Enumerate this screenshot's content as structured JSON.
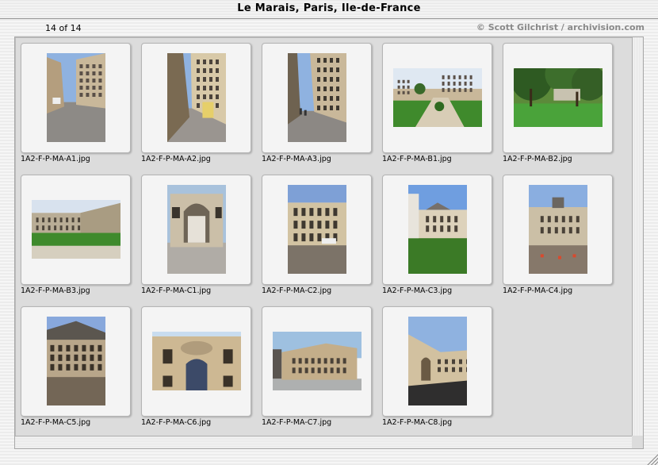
{
  "window": {
    "title": "Le Marais, Paris, Ile-de-France"
  },
  "header": {
    "counter": "14 of 14",
    "copyright": "© Scott Gilchrist / archivision.com"
  },
  "images": [
    {
      "filename": "1A2-F-P-MA-A1.jpg",
      "orientation": "portrait",
      "scene": "street-corner"
    },
    {
      "filename": "1A2-F-P-MA-A2.jpg",
      "orientation": "portrait",
      "scene": "narrow-street"
    },
    {
      "filename": "1A2-F-P-MA-A3.jpg",
      "orientation": "portrait",
      "scene": "street-tall"
    },
    {
      "filename": "1A2-F-P-MA-B1.jpg",
      "orientation": "landscape",
      "scene": "formal-garden"
    },
    {
      "filename": "1A2-F-P-MA-B2.jpg",
      "orientation": "landscape",
      "scene": "park-trees"
    },
    {
      "filename": "1A2-F-P-MA-B3.jpg",
      "orientation": "landscape",
      "scene": "courtyard-lawn"
    },
    {
      "filename": "1A2-F-P-MA-C1.jpg",
      "orientation": "portrait",
      "scene": "gateway"
    },
    {
      "filename": "1A2-F-P-MA-C2.jpg",
      "orientation": "portrait",
      "scene": "hotel-cobbles"
    },
    {
      "filename": "1A2-F-P-MA-C3.jpg",
      "orientation": "portrait",
      "scene": "garden-hotel"
    },
    {
      "filename": "1A2-F-P-MA-C4.jpg",
      "orientation": "portrait",
      "scene": "court-facade"
    },
    {
      "filename": "1A2-F-P-MA-C5.jpg",
      "orientation": "portrait",
      "scene": "renaissance-court"
    },
    {
      "filename": "1A2-F-P-MA-C6.jpg",
      "orientation": "landscape",
      "scene": "carved-portal"
    },
    {
      "filename": "1A2-F-P-MA-C7.jpg",
      "orientation": "landscape",
      "scene": "corner-building"
    },
    {
      "filename": "1A2-F-P-MA-C8.jpg",
      "orientation": "portrait",
      "scene": "curved-street"
    }
  ],
  "colors": {
    "sky": "#8fb2e0",
    "stone": "#c9b89a",
    "grass": "#3f8a2c",
    "pavement": "#8d8a86",
    "window_bg": "#dcdcdc"
  }
}
